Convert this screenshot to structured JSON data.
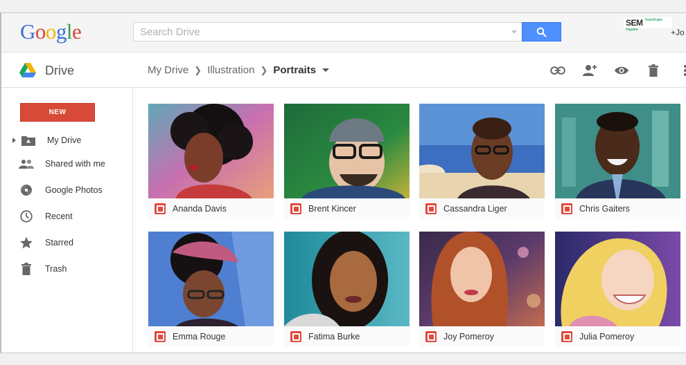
{
  "header": {
    "logo_letters": [
      "G",
      "o",
      "o",
      "g",
      "l",
      "e"
    ],
    "logo_colors": [
      "#3b6fd8",
      "#d9443a",
      "#f4b400",
      "#3b6fd8",
      "#3d9b4e",
      "#d9443a"
    ],
    "search_placeholder": "Search Drive",
    "watermark_text": "SEM",
    "watermark_small": "SearchEngine Magazine",
    "user_link": "+Jo"
  },
  "navbar": {
    "app_title": "Drive",
    "breadcrumb": [
      "My Drive",
      "Illustration"
    ],
    "breadcrumb_current": "Portraits",
    "actions": [
      "link-icon",
      "share-person-icon",
      "preview-eye-icon",
      "trash-icon",
      "more-vert-icon"
    ]
  },
  "sidebar": {
    "new_label": "NEW",
    "items": [
      {
        "label": "My Drive",
        "icon": "drive-folder-icon"
      },
      {
        "label": "Shared with me",
        "icon": "people-icon"
      },
      {
        "label": "Google Photos",
        "icon": "photos-pinwheel-icon"
      },
      {
        "label": "Recent",
        "icon": "clock-icon"
      },
      {
        "label": "Starred",
        "icon": "star-icon"
      },
      {
        "label": "Trash",
        "icon": "trash-icon"
      }
    ]
  },
  "files": [
    {
      "name": "Ananda Davis"
    },
    {
      "name": "Brent Kincer"
    },
    {
      "name": "Cassandra Liger"
    },
    {
      "name": "Chris Gaiters"
    },
    {
      "name": "Emma Rouge"
    },
    {
      "name": "Fatima Burke"
    },
    {
      "name": "Joy Pomeroy"
    },
    {
      "name": "Julia Pomeroy"
    }
  ],
  "colors": {
    "new_button": "#d84a38",
    "search_button": "#4d90fe",
    "file_icon": "#e04a3f"
  }
}
